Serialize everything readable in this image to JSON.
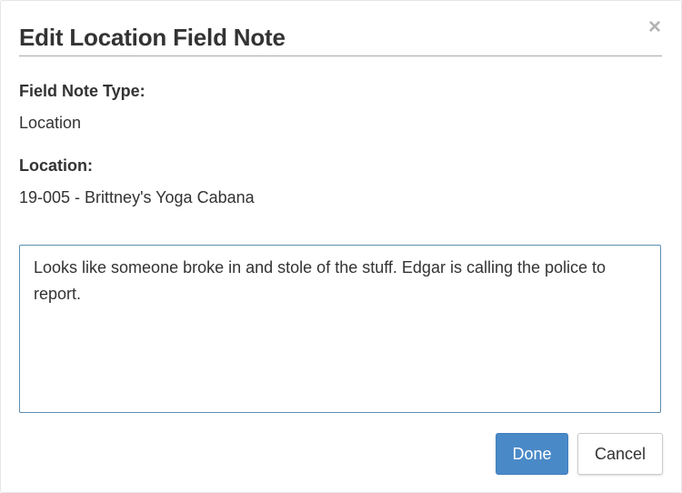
{
  "dialog": {
    "title": "Edit Location Field Note",
    "close_glyph": "×",
    "close_icon": "close-icon"
  },
  "fields": {
    "type_label": "Field Note Type:",
    "type_value": "Location",
    "location_label": "Location:",
    "location_value": "19-005 - Brittney's Yoga Cabana"
  },
  "notes": {
    "value": "Looks like someone broke in and stole of the stuff. Edgar is calling the police to report."
  },
  "buttons": {
    "done_label": "Done",
    "cancel_label": "Cancel"
  },
  "colors": {
    "primary": "#4a89c7",
    "input_border": "#5b8fb4",
    "text": "#333333"
  }
}
